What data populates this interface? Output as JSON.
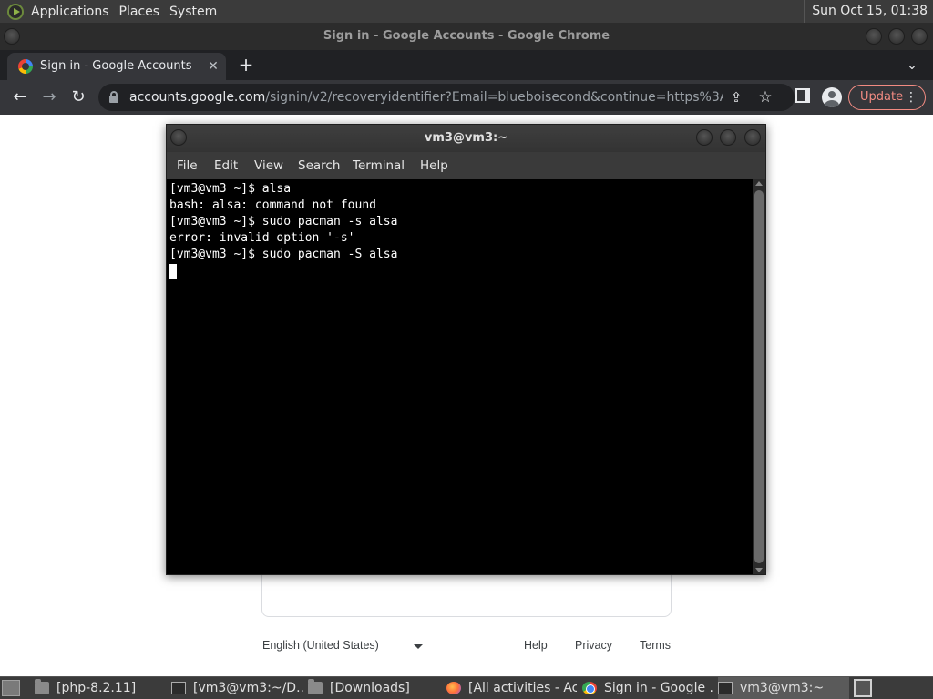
{
  "top_panel": {
    "menus": [
      "Applications",
      "Places",
      "System"
    ],
    "clock": "Sun Oct 15, 01:38"
  },
  "chrome": {
    "window_title": "Sign in - Google Accounts - Google Chrome",
    "tab_title": "Sign in - Google Accounts",
    "tab_close": "✕",
    "new_tab": "+",
    "tab_search": "⌄",
    "back": "←",
    "forward": "→",
    "reload": "↻",
    "url_host": "accounts.google.com",
    "url_path": "/signin/v2/recoveryidentifier?Email=blueboisecond&continue=https%3A%2F%2...",
    "share": "⇪",
    "star": "☆",
    "update_label": "Update",
    "menu_dots": "⋮"
  },
  "page": {
    "footer": {
      "language": "English (United States)",
      "help": "Help",
      "privacy": "Privacy",
      "terms": "Terms"
    }
  },
  "terminal": {
    "title": "vm3@vm3:~",
    "menus": [
      "File",
      "Edit",
      "View",
      "Search",
      "Terminal",
      "Help"
    ],
    "lines": [
      "[vm3@vm3 ~]$ alsa",
      "bash: alsa: command not found",
      "[vm3@vm3 ~]$ sudo pacman -s alsa",
      "error: invalid option '-s'",
      "[vm3@vm3 ~]$ sudo pacman -S alsa"
    ]
  },
  "taskbar": {
    "tasks": [
      "[php-8.2.11]",
      "[vm3@vm3:~/D...",
      "[Downloads]",
      "[All activities - Ac...",
      "Sign in - Google ...",
      "vm3@vm3:~"
    ]
  }
}
